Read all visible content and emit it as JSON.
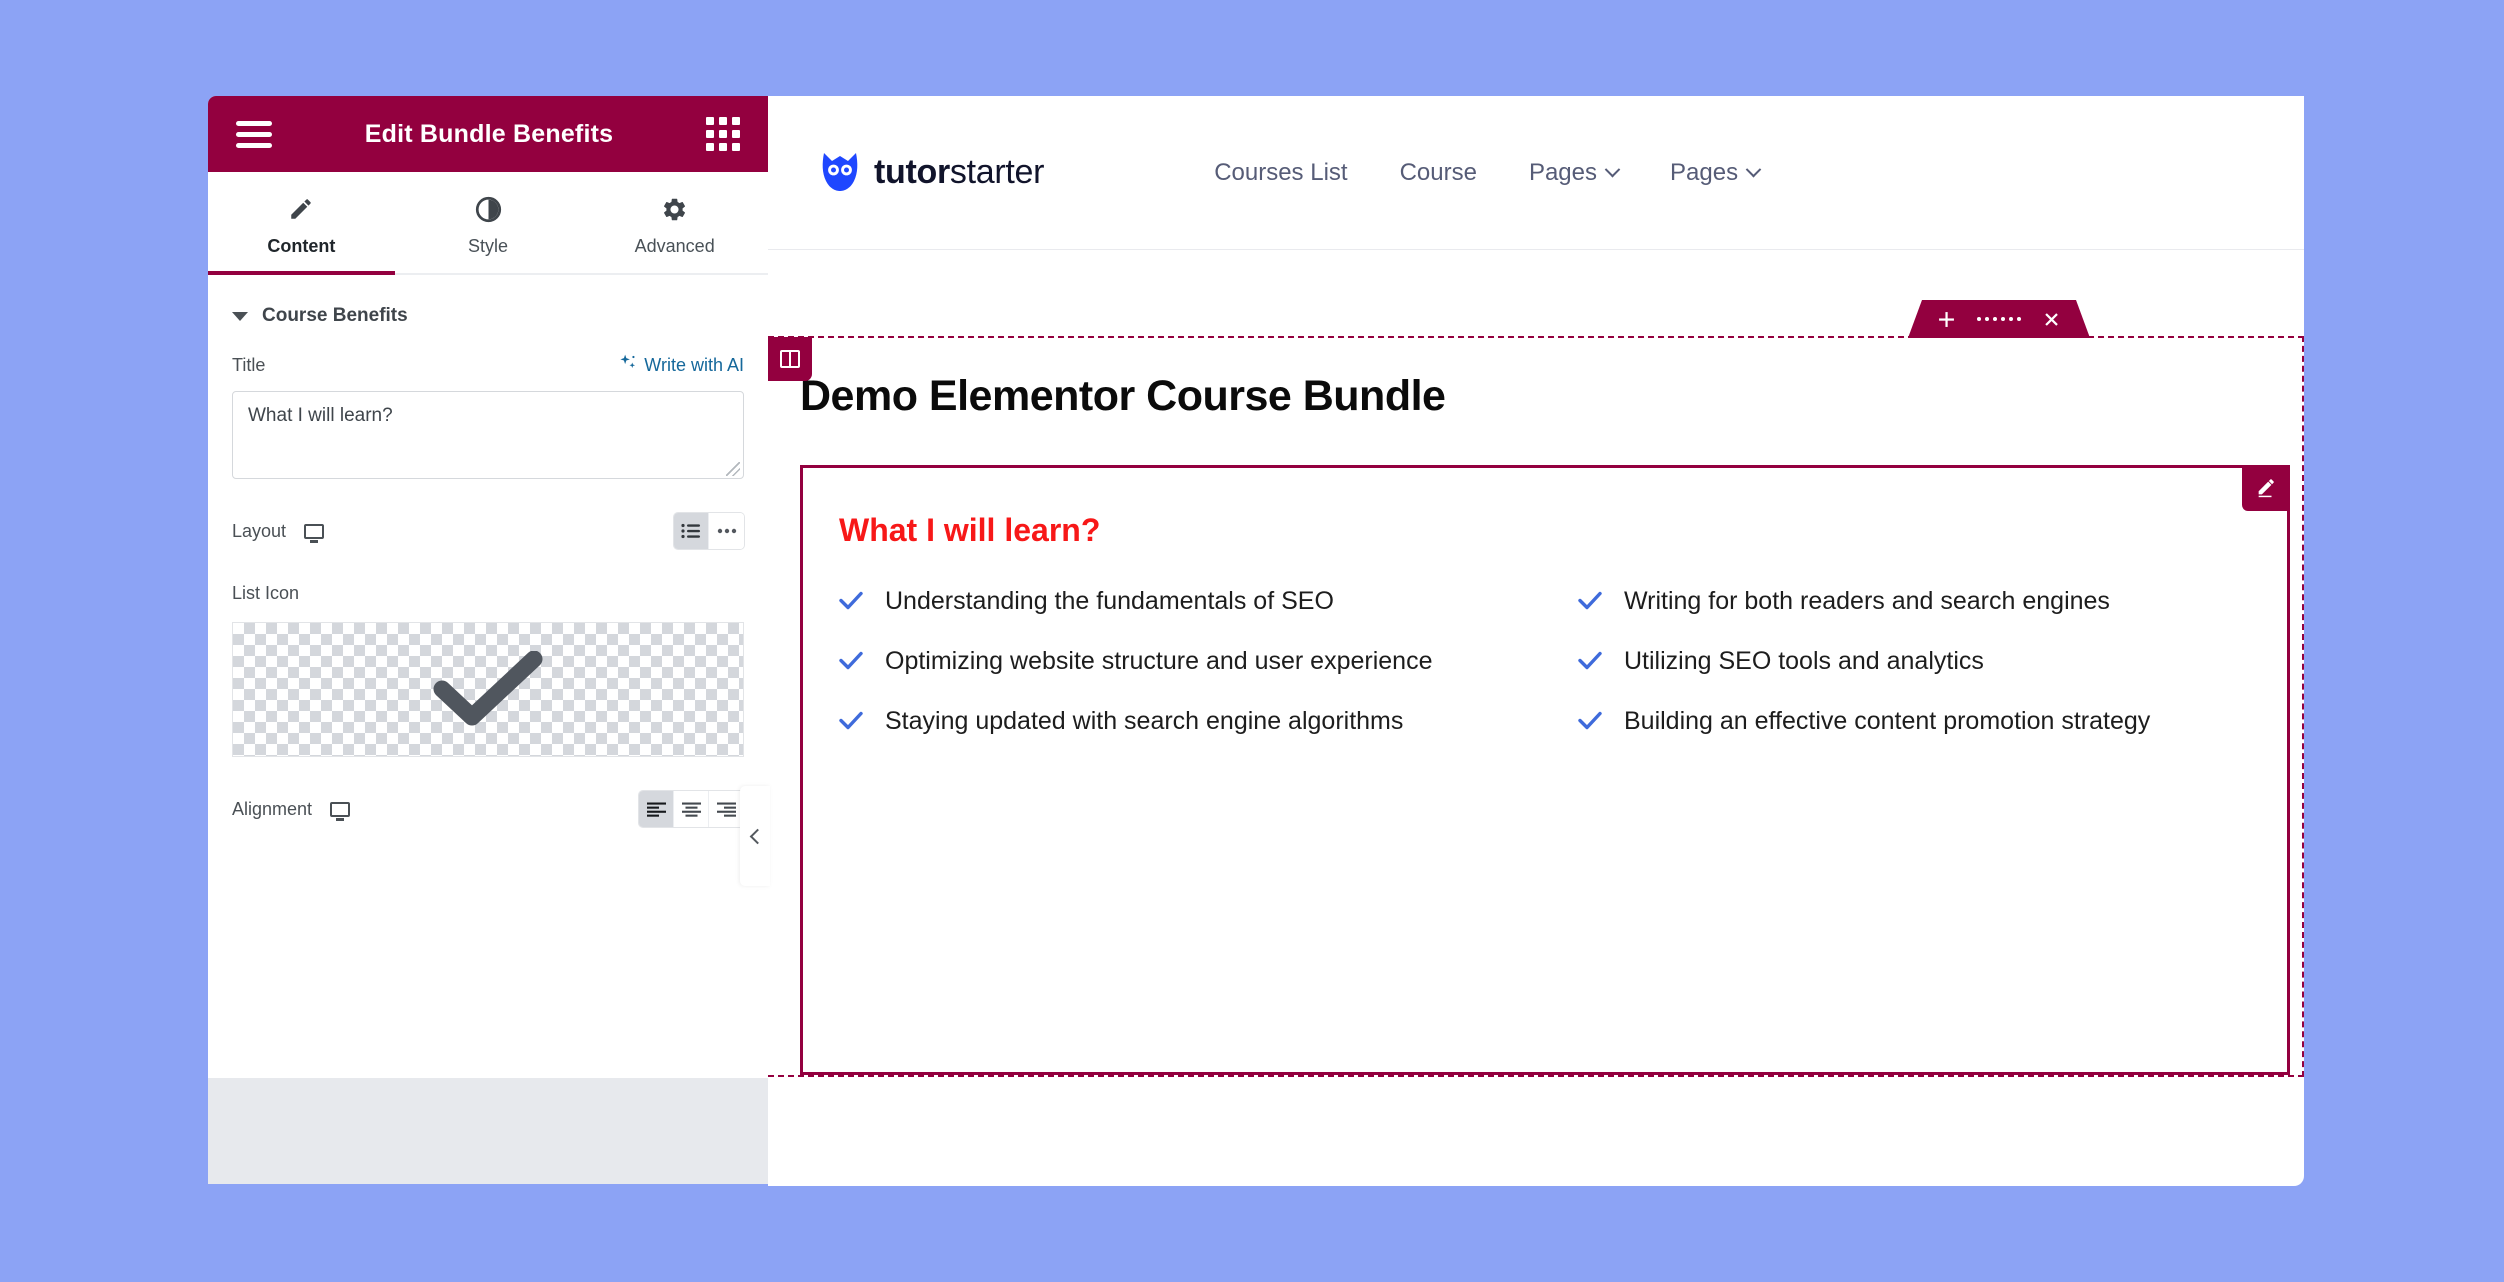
{
  "editor": {
    "header": {
      "title": "Edit Bundle Benefits",
      "menu_icon": "hamburger-menu-icon",
      "widgets_icon": "widgets-grid-icon"
    },
    "tabs": [
      {
        "label": "Content",
        "icon": "pencil-icon",
        "active": true
      },
      {
        "label": "Style",
        "icon": "contrast-half-circle-icon",
        "active": false
      },
      {
        "label": "Advanced",
        "icon": "gear-icon",
        "active": false
      }
    ],
    "section": {
      "title": "Course Benefits",
      "expanded": true
    },
    "controls": {
      "title": {
        "label": "Title",
        "ai_label": "Write with AI",
        "ai_icon": "sparkle-ai-icon",
        "value": "What I will learn?",
        "placeholder": ""
      },
      "layout": {
        "label": "Layout",
        "device_icon": "desktop-monitor-icon",
        "options": [
          {
            "name": "list",
            "icon": "bulleted-list-icon",
            "selected": true
          },
          {
            "name": "inline",
            "icon": "ellipsis-dots-icon",
            "selected": false
          }
        ]
      },
      "list_icon": {
        "label": "List Icon",
        "preview_icon": "checkmark-icon",
        "preview_background": "transparency-checkerboard"
      },
      "alignment": {
        "label": "Alignment",
        "device_icon": "desktop-monitor-icon",
        "options": [
          {
            "name": "left",
            "icon": "align-left-icon",
            "selected": true
          },
          {
            "name": "center",
            "icon": "align-center-icon",
            "selected": false
          },
          {
            "name": "right",
            "icon": "align-right-icon",
            "selected": false
          }
        ]
      }
    },
    "collapse_panel": {
      "icon": "chevron-left-icon"
    }
  },
  "preview": {
    "site_header": {
      "logo": {
        "icon": "owl-logo-icon",
        "bold_text": "tutor",
        "light_text": "starter"
      },
      "nav": [
        {
          "label": "Courses List",
          "has_dropdown": false
        },
        {
          "label": "Course",
          "has_dropdown": false
        },
        {
          "label": "Pages",
          "has_dropdown": true
        },
        {
          "label": "Pages",
          "has_dropdown": true
        }
      ]
    },
    "section_toolbar": {
      "add_icon": "plus-icon",
      "drag_icon": "drag-handle-dots-icon",
      "close_icon": "close-x-icon"
    },
    "column_handle": {
      "icon": "two-column-layout-icon"
    },
    "page_title": "Demo Elementor Course Bundle",
    "widget": {
      "edit_icon": "pencil-edit-icon",
      "title": "What I will learn?",
      "title_color": "#f71818",
      "check_icon": "blue-checkmark-icon",
      "check_color": "#3f6bdb",
      "benefits": [
        "Understanding the fundamentals of SEO",
        "Writing for both readers and search engines",
        "Optimizing website structure and user experience",
        "Utilizing SEO tools and analytics",
        "Staying updated with search engine algorithms",
        "Building an effective content promotion strategy"
      ]
    }
  },
  "theme": {
    "accent": "#93003f",
    "canvas_background": "#8ca3f5",
    "panel_footer": "#e7e9ed",
    "link_blue": "#15689b"
  }
}
